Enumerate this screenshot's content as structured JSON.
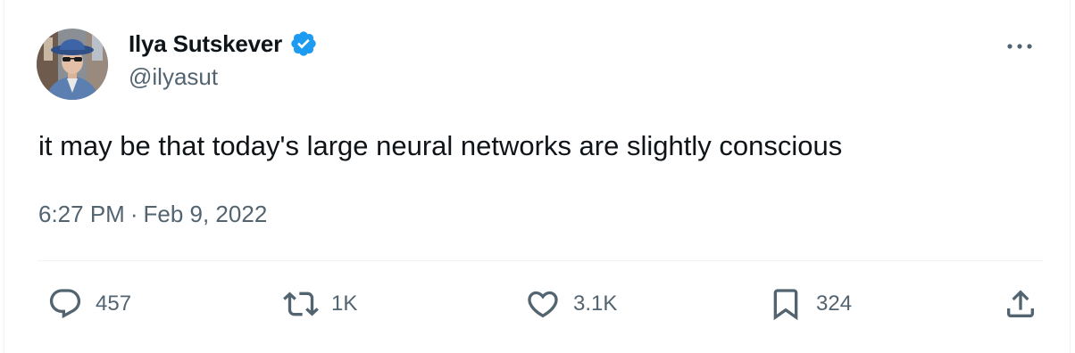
{
  "tweet": {
    "author": {
      "display_name": "Ilya Sutskever",
      "handle": "@ilyasut",
      "verified": true
    },
    "text": "it may be that today's large neural networks are slightly conscious",
    "time": "6:27 PM",
    "separator": "·",
    "date": "Feb 9, 2022",
    "stats": {
      "replies": "457",
      "reposts": "1K",
      "likes": "3.1K",
      "bookmarks": "324"
    }
  },
  "icons": {
    "verified": "verified-badge-icon",
    "more": "more-dots-icon",
    "reply": "reply-bubble-icon",
    "repost": "repost-arrows-icon",
    "like": "heart-icon",
    "bookmark": "bookmark-icon",
    "share": "share-upload-icon"
  },
  "colors": {
    "text": "#0f1419",
    "secondary": "#536471",
    "verified": "#1d9bf0",
    "divider": "#eff3f4"
  }
}
